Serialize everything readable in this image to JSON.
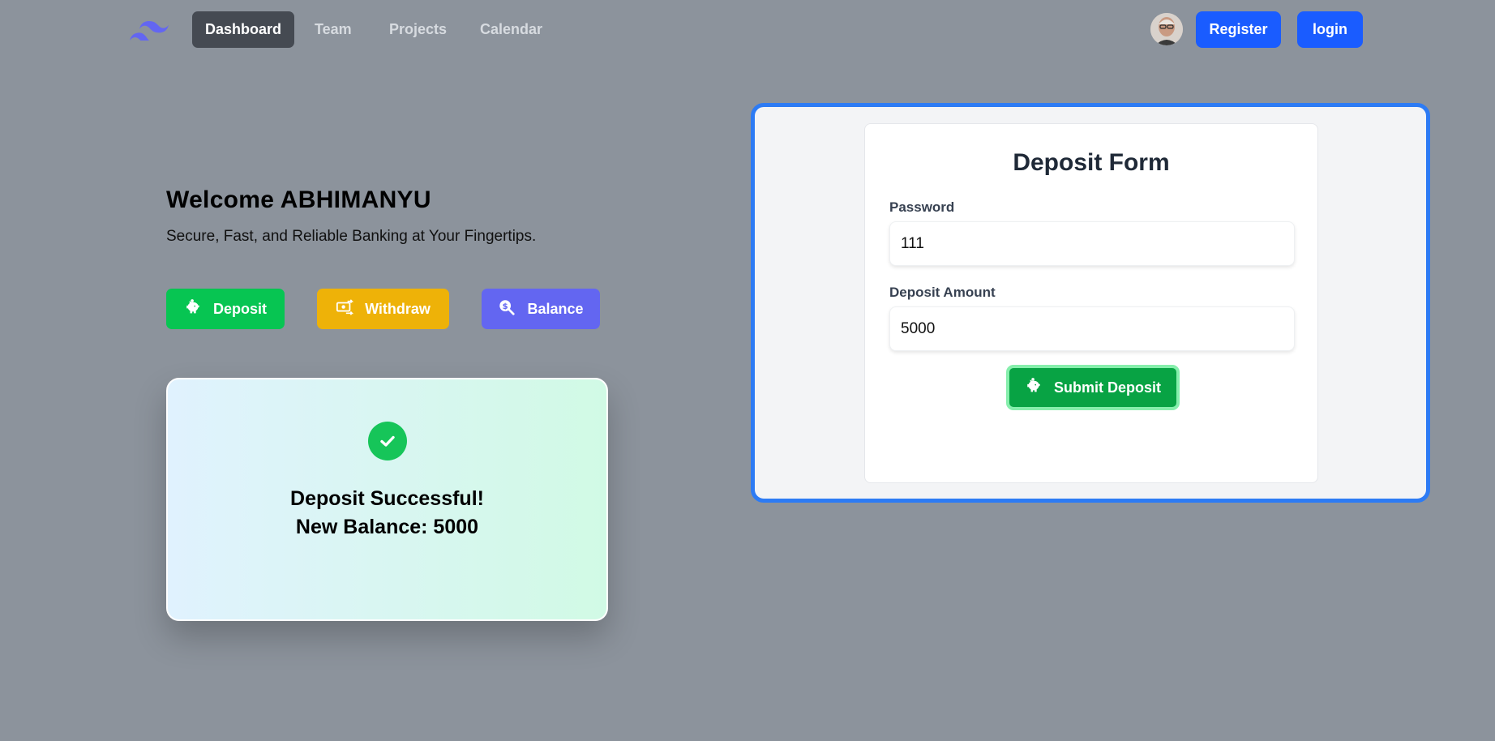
{
  "nav": {
    "logo_icon": "tailwind-wave-logo",
    "links": [
      {
        "label": "Dashboard",
        "active": true
      },
      {
        "label": "Team",
        "active": false
      },
      {
        "label": "Projects",
        "active": false
      },
      {
        "label": "Calendar",
        "active": false
      }
    ],
    "register_label": "Register",
    "login_label": "login"
  },
  "hero": {
    "welcome": "Welcome ABHIMANYU",
    "tagline": "Secure, Fast, and Reliable Banking at Your Fingertips."
  },
  "actions": [
    {
      "label": "Deposit",
      "icon": "piggy-bank-icon",
      "color": "#07c552"
    },
    {
      "label": "Withdraw",
      "icon": "money-transfer-icon",
      "color": "#eeb208"
    },
    {
      "label": "Balance",
      "icon": "search-dollar-icon",
      "color": "#6366f1"
    }
  ],
  "result": {
    "icon": "check-circle-icon",
    "line1": "Deposit Successful!",
    "line2": "New Balance: 5000"
  },
  "form": {
    "title": "Deposit Form",
    "password_label": "Password",
    "password_value": "111",
    "amount_label": "Deposit Amount",
    "amount_value": "5000",
    "submit_label": "Submit Deposit",
    "submit_icon": "piggy-bank-icon"
  },
  "colors": {
    "background": "#8c939c",
    "primary_blue": "#1a5cff",
    "panel_border": "#2d7bf4",
    "success_green": "#16c559"
  }
}
